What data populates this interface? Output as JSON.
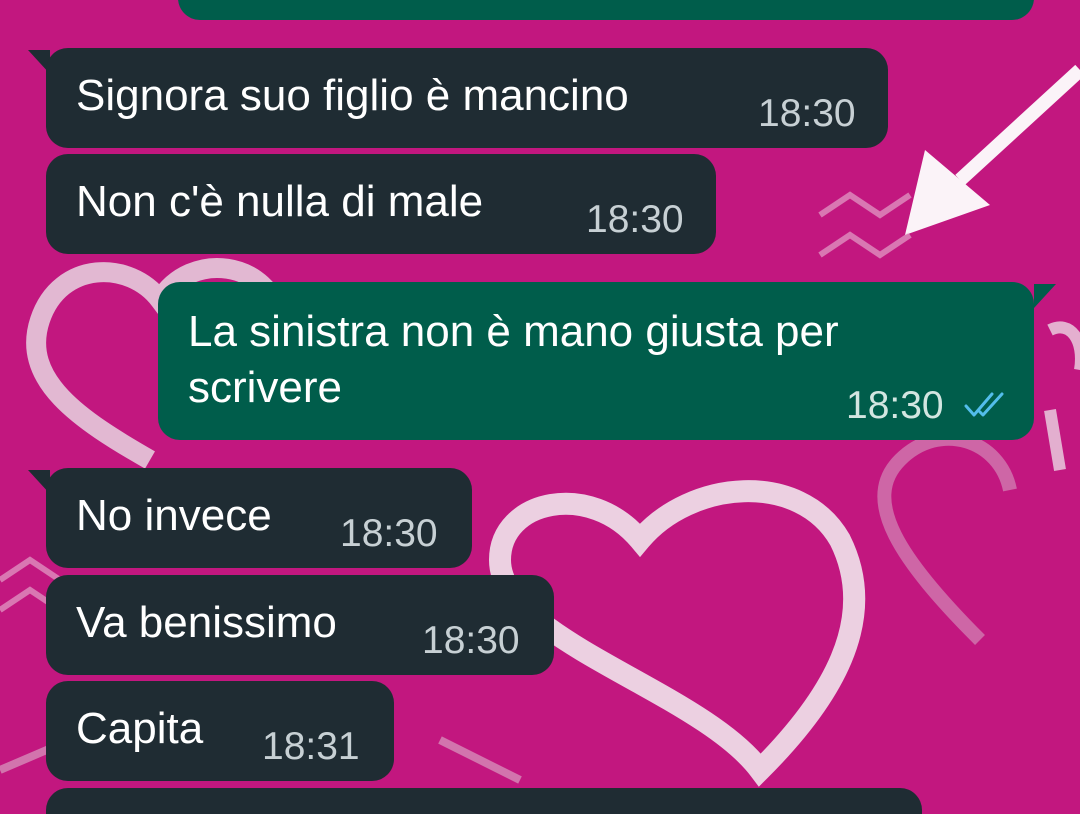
{
  "chat": {
    "messages": [
      {
        "direction": "incoming",
        "text": "Signora suo figlio è mancino",
        "time": "18:30"
      },
      {
        "direction": "incoming",
        "text": "Non c'è nulla di male",
        "time": "18:30"
      },
      {
        "direction": "outgoing",
        "text": "La sinistra non è mano giusta per scrivere",
        "time": "18:30",
        "status": "read-double-check-icon"
      },
      {
        "direction": "incoming",
        "text": "No invece",
        "time": "18:30"
      },
      {
        "direction": "incoming",
        "text": "Va benissimo",
        "time": "18:30"
      },
      {
        "direction": "incoming",
        "text": "Capita",
        "time": "18:31"
      }
    ]
  },
  "colors": {
    "wallpaper": "#c2177f",
    "incoming_bubble": "#1f2c33",
    "outgoing_bubble": "#005d4b",
    "read_ticks": "#53bdeb"
  }
}
